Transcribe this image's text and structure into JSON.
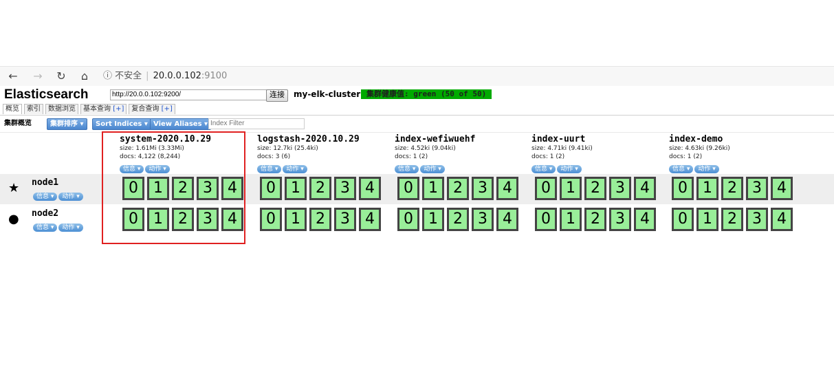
{
  "browser": {
    "back_icon": "←",
    "forward_icon": "→",
    "reload_icon": "↻",
    "home_icon": "⌂",
    "info_icon": "ⓘ",
    "security_label": "不安全",
    "host": "20.0.0.102",
    "port": ":9100"
  },
  "header": {
    "title": "Elasticsearch",
    "connection_url": "http://20.0.0.102:9200/",
    "connect_label": "连接",
    "cluster_name": "my-elk-cluster",
    "cluster_health": "集群健康值: green (50 of 50)",
    "health_color": "#00aa00"
  },
  "tabs": [
    {
      "label": "概览",
      "plus": ""
    },
    {
      "label": "索引",
      "plus": ""
    },
    {
      "label": "数据浏览",
      "plus": ""
    },
    {
      "label": "基本查询 ",
      "plus": "[+]"
    },
    {
      "label": "复合查询 ",
      "plus": "[+]"
    }
  ],
  "toolbar": {
    "overview_label": "集群概览",
    "cluster_sort_label": "集群排序 ▾",
    "sort_indices_label": "Sort Indices ▾",
    "view_aliases_label": "View Aliases ▾",
    "index_filter_placeholder": "Index Filter"
  },
  "pill_labels": {
    "info": "信息 ▾",
    "action": "动作 ▾"
  },
  "indices": [
    {
      "name": "system-2020.10.29",
      "size": "size: 1.61Mi (3.33Mi)",
      "docs": "docs: 4,122 (8,244)"
    },
    {
      "name": "logstash-2020.10.29",
      "size": "size: 12.7ki (25.4ki)",
      "docs": "docs: 3 (6)"
    },
    {
      "name": "index-wefiwuehf",
      "size": "size: 4.52ki (9.04ki)",
      "docs": "docs: 1 (2)"
    },
    {
      "name": "index-uurt",
      "size": "size: 4.71ki (9.41ki)",
      "docs": "docs: 1 (2)"
    },
    {
      "name": "index-demo",
      "size": "size: 4.63ki (9.26ki)",
      "docs": "docs: 1 (2)"
    }
  ],
  "nodes": [
    {
      "name": "node1",
      "icon": "★",
      "icon_name": "star-icon"
    },
    {
      "name": "node2",
      "icon": "●",
      "icon_name": "circle-icon"
    }
  ],
  "shard_labels": [
    "0",
    "1",
    "2",
    "3",
    "4"
  ],
  "shard_color": "#99ee99",
  "highlight_color": "#e02020"
}
